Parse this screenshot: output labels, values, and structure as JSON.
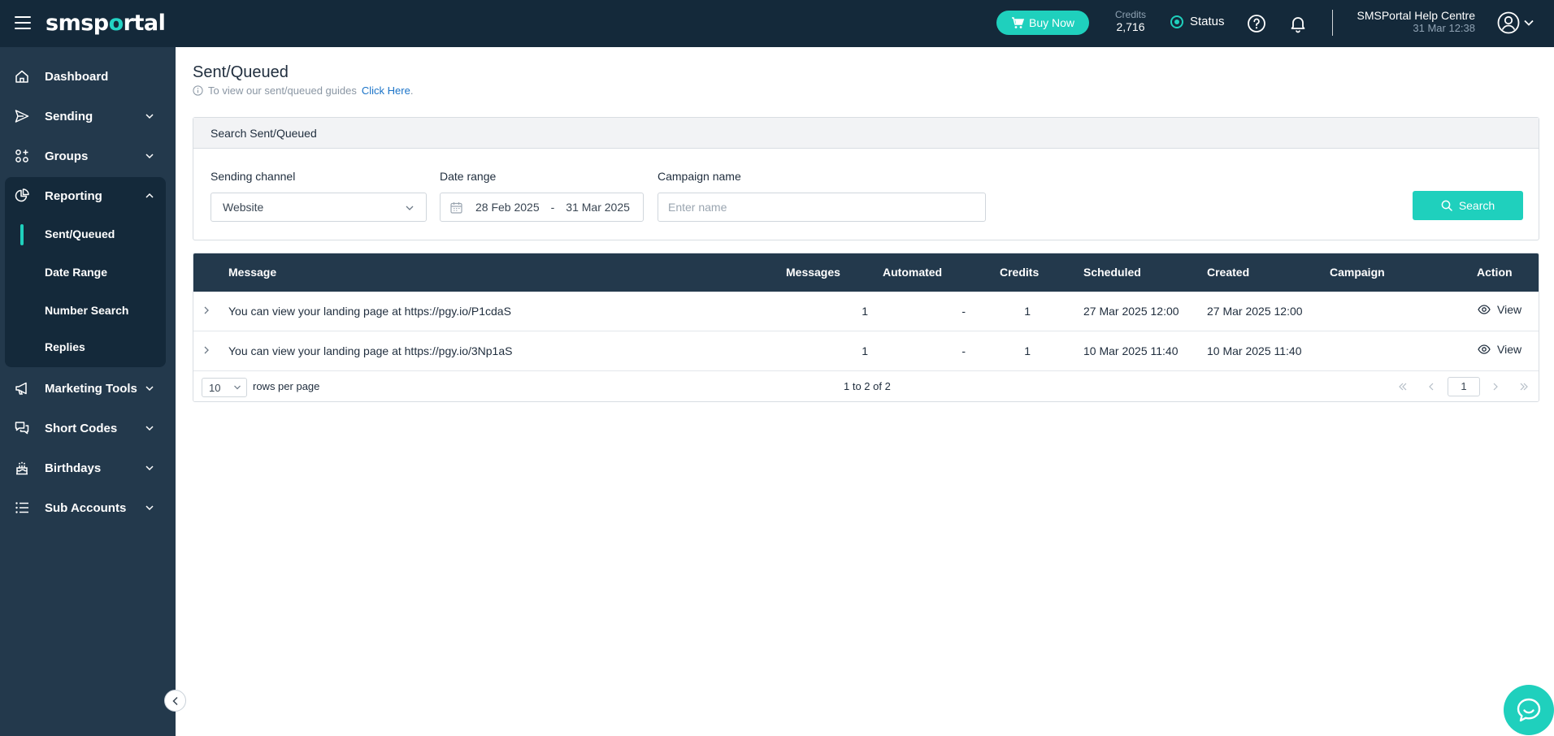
{
  "header": {
    "logo_prefix": "smsp",
    "logo_o": "o",
    "logo_suffix": "rtal",
    "buy_label": "Buy Now",
    "credits_label": "Credits",
    "credits_value": "2,716",
    "status_label": "Status",
    "help_title": "SMSPortal Help Centre",
    "help_datetime": "31 Mar 12:38"
  },
  "sidebar": {
    "items": [
      {
        "label": "Dashboard",
        "icon": "home-icon"
      },
      {
        "label": "Sending",
        "icon": "send-icon"
      },
      {
        "label": "Groups",
        "icon": "groups-icon"
      },
      {
        "label": "Reporting",
        "icon": "pie-chart-icon"
      },
      {
        "label": "Marketing Tools",
        "icon": "megaphone-icon"
      },
      {
        "label": "Short Codes",
        "icon": "chat-bubbles-icon"
      },
      {
        "label": "Birthdays",
        "icon": "cake-icon"
      },
      {
        "label": "Sub Accounts",
        "icon": "list-icon"
      }
    ],
    "reporting_sub": [
      "Sent/Queued",
      "Date Range",
      "Number Search",
      "Replies"
    ]
  },
  "page": {
    "title": "Sent/Queued",
    "hint_text": "To view our sent/queued guides",
    "hint_link": "Click Here",
    "hint_period": "."
  },
  "search": {
    "header": "Search Sent/Queued",
    "channel_label": "Sending channel",
    "channel_value": "Website",
    "date_label": "Date range",
    "date_from": "28 Feb 2025",
    "date_sep": "-",
    "date_to": "31 Mar 2025",
    "campaign_label": "Campaign name",
    "campaign_placeholder": "Enter name",
    "button_label": "Search"
  },
  "table": {
    "columns": [
      "Message",
      "Messages",
      "Automated",
      "Credits",
      "Scheduled",
      "Created",
      "Campaign",
      "Action"
    ],
    "rows": [
      {
        "message": "You can view your landing page at https://pgy.io/P1cdaS",
        "messages": "1",
        "automated": "-",
        "credits": "1",
        "scheduled": "27 Mar 2025 12:00",
        "created": "27 Mar 2025 12:00",
        "campaign": "",
        "action": "View"
      },
      {
        "message": "You can view your landing page at https://pgy.io/3Np1aS",
        "messages": "1",
        "automated": "-",
        "credits": "1",
        "scheduled": "10 Mar 2025 11:40",
        "created": "10 Mar 2025 11:40",
        "campaign": "",
        "action": "View"
      }
    ],
    "rows_per_page": "10",
    "rows_per_page_label": "rows per page",
    "range_text": "1 to 2 of 2",
    "current_page": "1"
  },
  "colors": {
    "topbar": "#14293a",
    "sidebar": "#23394c",
    "accent": "#1fd0bd",
    "link": "#1a73c8"
  }
}
